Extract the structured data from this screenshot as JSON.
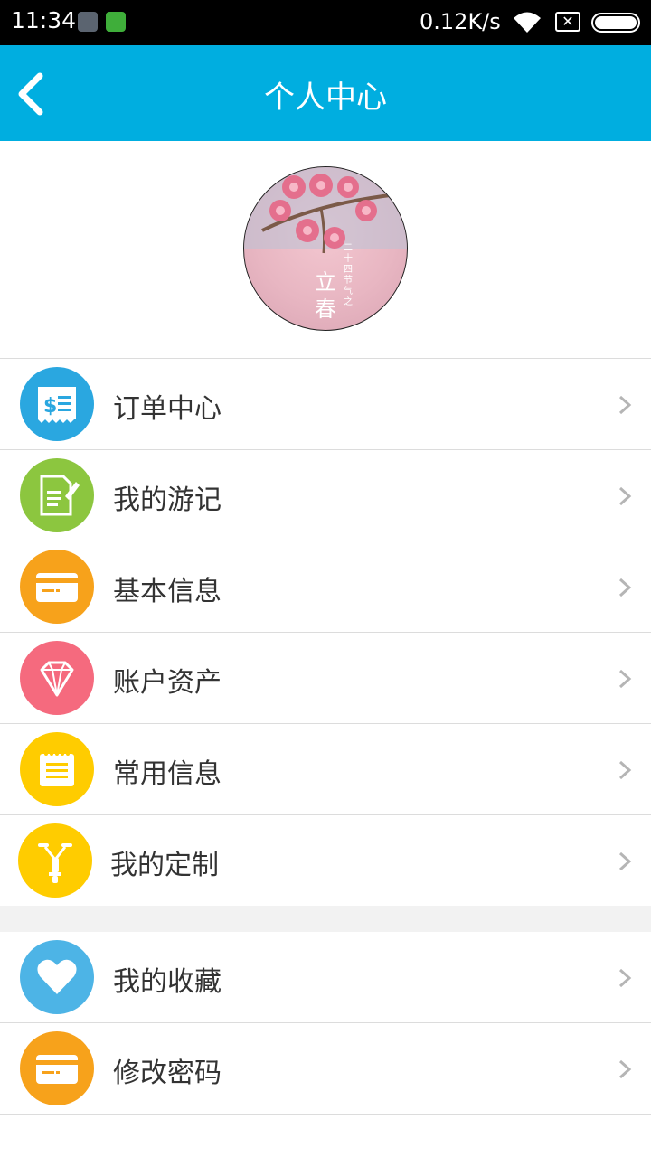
{
  "status_bar": {
    "time": "11:34",
    "network_speed": "0.12K/s",
    "sim_icon": "sim-blocked-icon",
    "wifi_icon": "wifi-icon",
    "battery_icon": "battery-full-icon"
  },
  "header": {
    "title": "个人中心",
    "back_icon": "chevron-left-icon",
    "background": "#00aee0"
  },
  "profile": {
    "avatar_icon": "avatar-image-cherry-blossom",
    "avatar_text_vertical": "二十四节气之",
    "avatar_text_large": "立春"
  },
  "menu": {
    "items": [
      {
        "label": "订单中心",
        "icon": "receipt-dollar-icon",
        "color": "#2aa7e0"
      },
      {
        "label": "我的游记",
        "icon": "document-edit-icon",
        "color": "#8cc63f"
      },
      {
        "label": "基本信息",
        "icon": "card-icon",
        "color": "#f7a21b"
      },
      {
        "label": "账户资产",
        "icon": "diamond-icon",
        "color": "#f56a7e"
      },
      {
        "label": "常用信息",
        "icon": "notepad-icon",
        "color": "#ffcc00"
      },
      {
        "label": "我的定制",
        "icon": "scooter-icon",
        "color": "#ffcc00"
      }
    ],
    "items2": [
      {
        "label": "我的收藏",
        "icon": "heart-icon",
        "color": "#4db4e6"
      },
      {
        "label": "修改密码",
        "icon": "card-icon",
        "color": "#f7a21b"
      }
    ]
  }
}
